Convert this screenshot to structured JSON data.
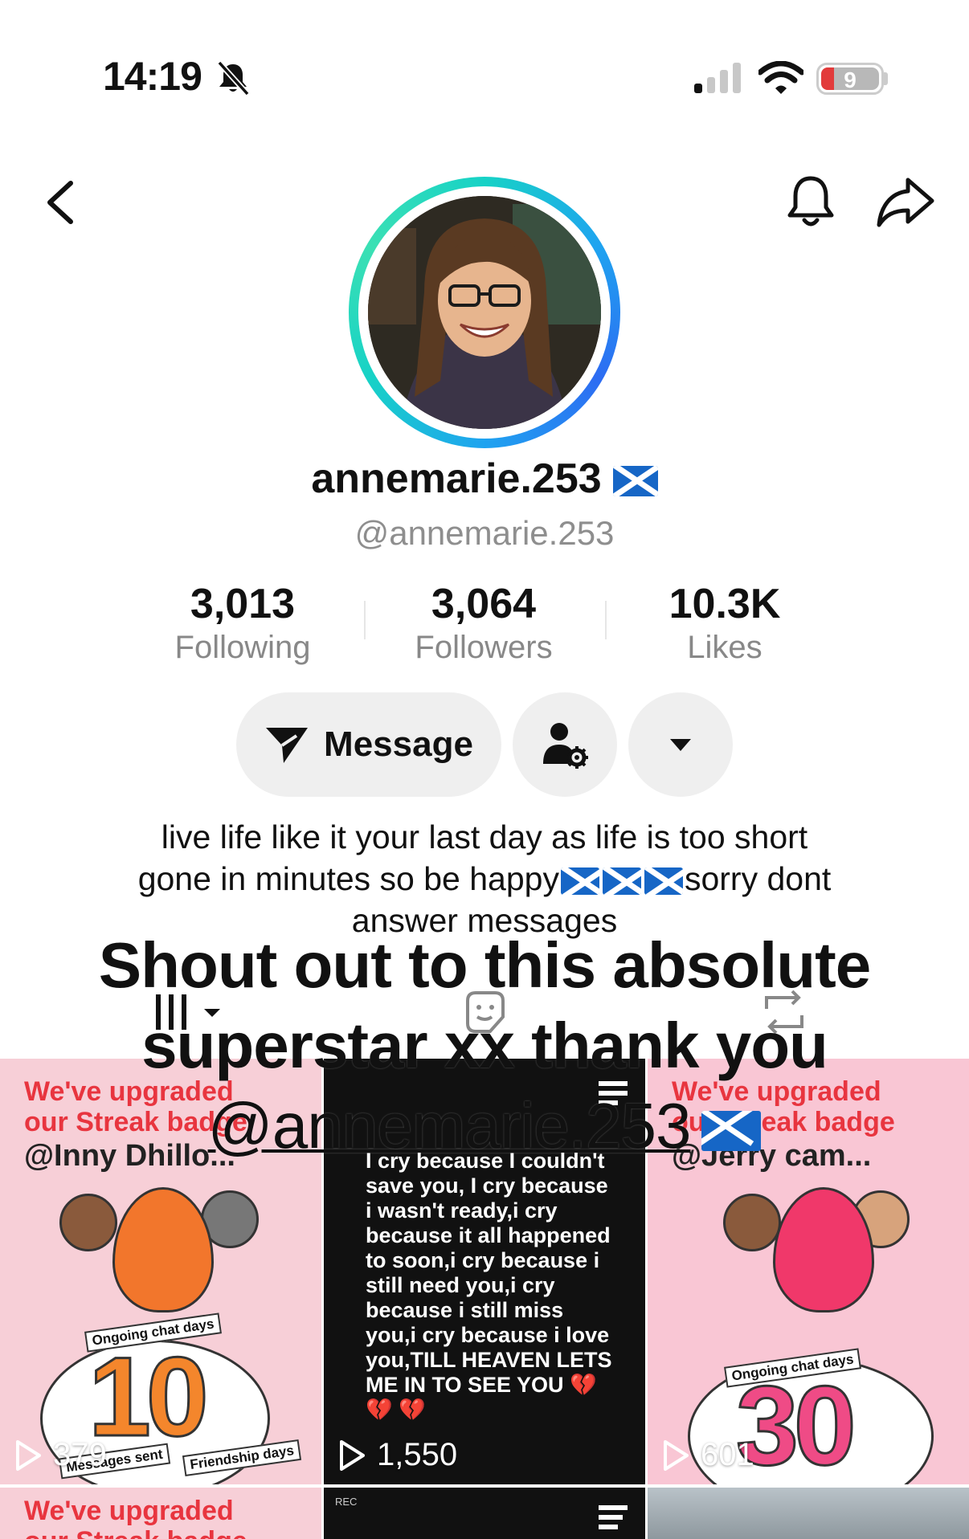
{
  "status_bar": {
    "time": "14:19",
    "battery": "9"
  },
  "profile": {
    "display_name": "annemarie.253",
    "username": "@annemarie.253",
    "stats": [
      {
        "value": "3,013",
        "label": "Following"
      },
      {
        "value": "3,064",
        "label": "Followers"
      },
      {
        "value": "10.3K",
        "label": "Likes"
      }
    ],
    "message_label": "Message",
    "bio_line1": "live life like it your last day as life is too short",
    "bio_line2a": "gone in minutes so be happy",
    "bio_line2b": "sorry dont",
    "bio_line3": "answer messages"
  },
  "overlay": {
    "line1": "Shout out to this absolute",
    "line2": "superstar xx thank you",
    "mention": "@annemarie.253"
  },
  "videos": [
    {
      "title": "We've upgraded our Streak badge",
      "user": "@Inny Dhillo...",
      "number": "10",
      "chip1": "Ongoing chat days",
      "chip2": "Messages sent",
      "chip3": "Friendship days",
      "plays": "379"
    },
    {
      "text": "I cry because I couldn't save you, I cry because i wasn't ready,i cry because it all happened to soon,i cry because i still need you,i cry because i still miss you,i cry because i love you,TILL HEAVEN LETS ME IN TO SEE YOU 💔 💔 💔",
      "plays": "1,550"
    },
    {
      "title": "We've upgraded our Streak badge",
      "user": "@Jerry cam...",
      "number": "30",
      "chip1": "Ongoing chat days",
      "plays": "601"
    },
    {
      "title": "We've upgraded our Streak badge"
    },
    {
      "rec": "REC"
    },
    {}
  ],
  "colors": {
    "accent_red": "#e8353f",
    "pink_tile": "#f7cfd7",
    "ring": "#1fa3f0"
  }
}
